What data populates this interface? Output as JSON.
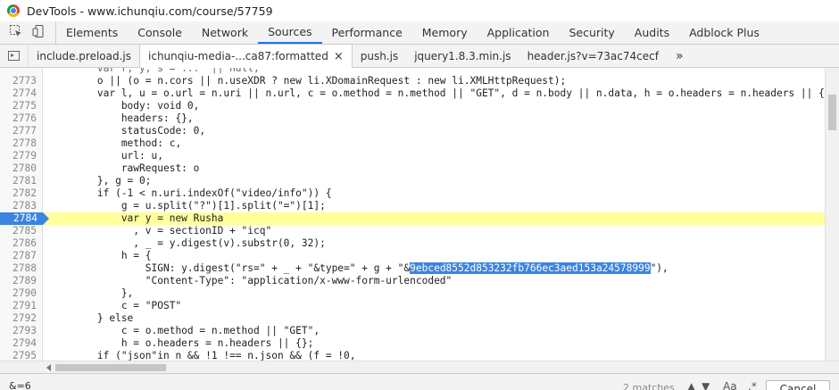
{
  "window": {
    "title": "DevTools - www.ichunqiu.com/course/57759"
  },
  "toolbar": {
    "tabs": [
      "Elements",
      "Console",
      "Network",
      "Sources",
      "Performance",
      "Memory",
      "Application",
      "Security",
      "Audits",
      "Adblock Plus"
    ],
    "active_tab": "Sources"
  },
  "file_tabs": {
    "tabs": [
      "include.preload.js",
      "ichunqiu-media-...ca87:formatted",
      "push.js",
      "jquery1.8.3.min.js",
      "header.js?v=73ac74cecf"
    ],
    "active_index": 1,
    "more": "»",
    "close_glyph": "×"
  },
  "editor": {
    "current_line": 2784,
    "lines": [
      {
        "num": "",
        "pre": "        var r, y, s = ...  || null;",
        "sel": "",
        "post": ""
      },
      {
        "num": "2773",
        "pre": "        o || (o = n.cors || n.useXDR ? new li.XDomainRequest : new li.XMLHttpRequest);",
        "sel": "",
        "post": ""
      },
      {
        "num": "2774",
        "pre": "        var l, u = o.url = n.uri || n.url, c = o.method = n.method || \"GET\", d = n.body || n.data, h = o.headers = n.headers || {}, p =",
        "sel": "",
        "post": ""
      },
      {
        "num": "2775",
        "pre": "            body: void 0,",
        "sel": "",
        "post": ""
      },
      {
        "num": "2776",
        "pre": "            headers: {},",
        "sel": "",
        "post": ""
      },
      {
        "num": "2777",
        "pre": "            statusCode: 0,",
        "sel": "",
        "post": ""
      },
      {
        "num": "2778",
        "pre": "            method: c,",
        "sel": "",
        "post": ""
      },
      {
        "num": "2779",
        "pre": "            url: u,",
        "sel": "",
        "post": ""
      },
      {
        "num": "2780",
        "pre": "            rawRequest: o",
        "sel": "",
        "post": ""
      },
      {
        "num": "2781",
        "pre": "        }, g = 0;",
        "sel": "",
        "post": ""
      },
      {
        "num": "2782",
        "pre": "        if (-1 < n.uri.indexOf(\"video/info\")) {",
        "sel": "",
        "post": ""
      },
      {
        "num": "2783",
        "pre": "            g = u.split(\"?\")[1].split(\"=\")[1];",
        "sel": "",
        "post": ""
      },
      {
        "num": "2784",
        "pre": "            var y = new Rusha",
        "sel": "",
        "post": ""
      },
      {
        "num": "2785",
        "pre": "              , v = sectionID + \"icq\"",
        "sel": "",
        "post": ""
      },
      {
        "num": "2786",
        "pre": "              , _ = y.digest(v).substr(0, 32);",
        "sel": "",
        "post": ""
      },
      {
        "num": "2787",
        "pre": "            h = {",
        "sel": "",
        "post": ""
      },
      {
        "num": "2788",
        "pre": "                SIGN: y.digest(\"rs=\" + _ + \"&type=\" + g + \"&",
        "sel": "9ebced8552d853232fb766ec3aed153a24578999",
        "post": "\"),"
      },
      {
        "num": "2789",
        "pre": "                \"Content-Type\": \"application/x-www-form-urlencoded\"",
        "sel": "",
        "post": ""
      },
      {
        "num": "2790",
        "pre": "            },",
        "sel": "",
        "post": ""
      },
      {
        "num": "2791",
        "pre": "            c = \"POST\"",
        "sel": "",
        "post": ""
      },
      {
        "num": "2792",
        "pre": "        } else",
        "sel": "",
        "post": ""
      },
      {
        "num": "2793",
        "pre": "            c = o.method = n.method || \"GET\",",
        "sel": "",
        "post": ""
      },
      {
        "num": "2794",
        "pre": "            h = o.headers = n.headers || {};",
        "sel": "",
        "post": ""
      },
      {
        "num": "2795",
        "pre": "        if (\"json\"in n && !1 !== n.json && (f = !0,",
        "sel": "",
        "post": ""
      },
      {
        "num": "2796",
        "pre": "",
        "sel": "",
        "post": ""
      }
    ]
  },
  "search": {
    "value": "&=6",
    "matches": "2 matches",
    "case_label": "Aa",
    "regex_label": ".*",
    "cancel_label": "Cancel"
  }
}
